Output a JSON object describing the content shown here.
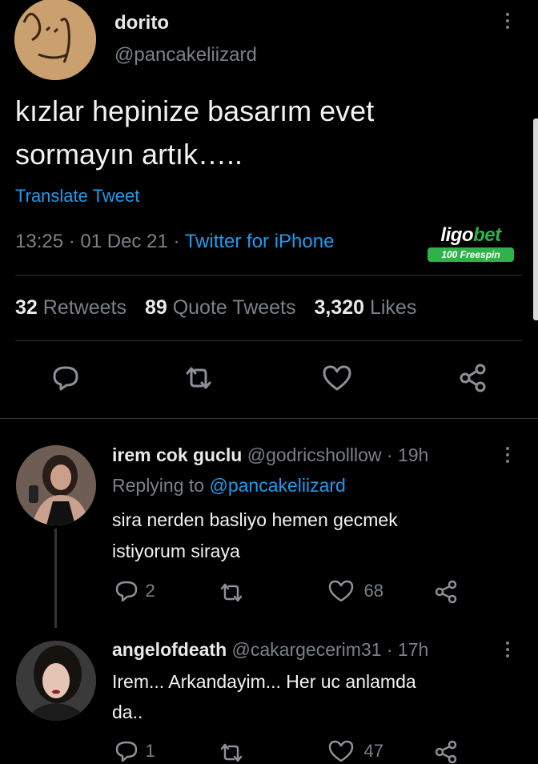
{
  "main_tweet": {
    "display_name": "dorito",
    "handle": "@pancakeliizard",
    "text_line1": "kızlar hepinize basarım evet",
    "text_line2": "sormayın artık…..",
    "translate_label": "Translate Tweet",
    "timestamp": "13:25 · 01 Dec 21 ·",
    "source": "Twitter for iPhone",
    "stats": {
      "retweets_count": "32",
      "retweets_label": "Retweets",
      "quotes_count": "89",
      "quotes_label": "Quote Tweets",
      "likes_count": "3,320",
      "likes_label": "Likes"
    }
  },
  "watermark": {
    "brand_part1": "ligo",
    "brand_part2": "bet",
    "badge": "100 Freespin"
  },
  "replies": [
    {
      "display_name": "irem cok guclu",
      "handle_time": "@godricsholllow · 19h",
      "replying_label": "Replying to",
      "replying_handle": "@pancakeliizard",
      "text_line1": "sira nerden basliyo hemen gecmek",
      "text_line2": "istiyorum siraya",
      "reply_count": "2",
      "like_count": "68"
    },
    {
      "display_name": "angelofdeath",
      "handle_time": "@cakargecerim31 · 17h",
      "text_line1": "Irem... Arkandayim... Her uc anlamda",
      "text_line2": "da..",
      "reply_count": "1",
      "like_count": "47"
    }
  ],
  "colors": {
    "background": "#000000",
    "text": "#e7e9ea",
    "muted": "#7b8188",
    "link": "#1d9bf0",
    "brand_green": "#2fb24c"
  },
  "icons": [
    "more-icon",
    "reply-icon",
    "retweet-icon",
    "like-icon",
    "share-icon"
  ]
}
